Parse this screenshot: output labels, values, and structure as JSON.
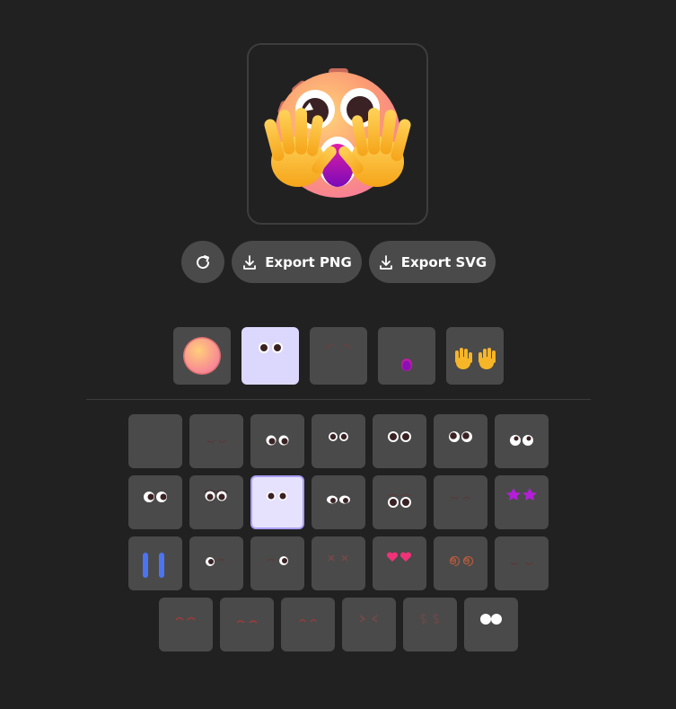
{
  "toolbar": {
    "refresh_icon": "refresh-icon",
    "export_png_label": "Export PNG",
    "export_svg_label": "Export SVG",
    "download_icon": "download-icon"
  },
  "categories": [
    {
      "id": "face",
      "icon": "face-base-icon",
      "selected": false
    },
    {
      "id": "eyes",
      "icon": "eyes-icon",
      "selected": true
    },
    {
      "id": "eyebrows",
      "icon": "eyebrows-icon",
      "selected": false
    },
    {
      "id": "mouth",
      "icon": "mouth-icon",
      "selected": false
    },
    {
      "id": "hands",
      "icon": "hands-icon",
      "selected": false
    }
  ],
  "eye_options": [
    "none",
    "closed-smile",
    "wide-eyes",
    "round-eyes",
    "big-round-eyes",
    "glancing-eyes",
    "white-eyes",
    "side-eyes",
    "worried-eyes",
    "selected-round-eyes",
    "squint-eyes",
    "teary-eyes",
    "closed-calm",
    "star-eyes",
    "blue-tall-eyes",
    "wink-left",
    "wink-right",
    "x-eyes",
    "heart-eyes",
    "spiral-eyes",
    "relaxed-closed",
    "happy-closed",
    "soft-closed",
    "arched-closed",
    "squeezed-eyes",
    "dollar-eyes",
    "solid-white-eyes"
  ],
  "selected_eye": "selected-round-eyes",
  "colors": {
    "background": "#212121",
    "tile": "#4a4a4a",
    "selected_tile": "#e6e2fd",
    "selected_border": "#a99ef5"
  }
}
